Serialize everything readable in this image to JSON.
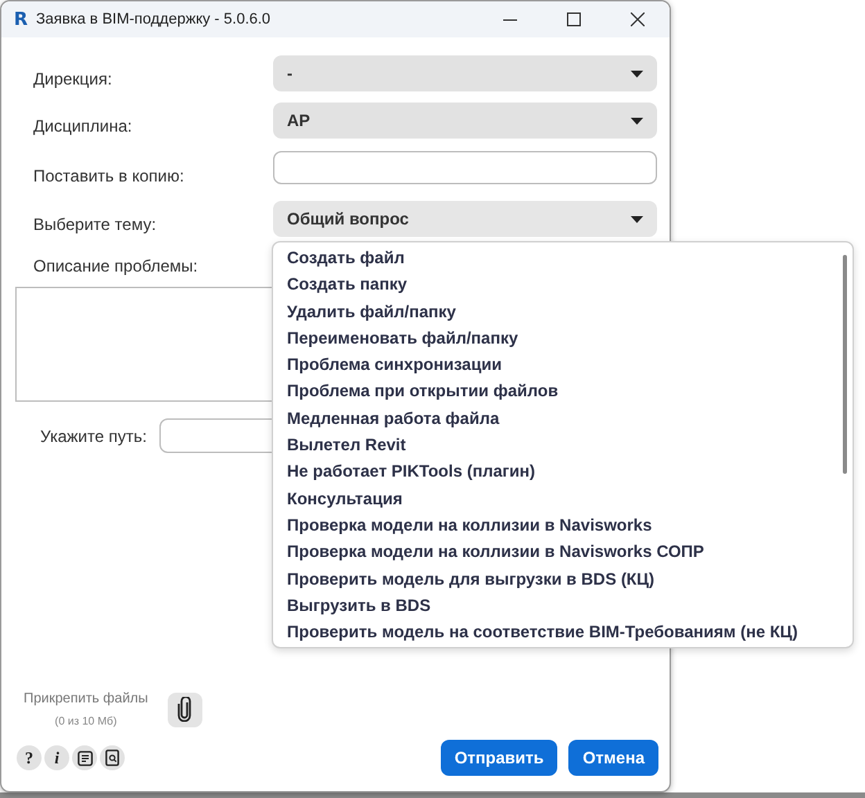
{
  "window": {
    "app_letter": "R",
    "title": "Заявка в BIM-поддержку - 5.0.6.0"
  },
  "fields": [
    {
      "kind": "combo",
      "label": "Дирекция:",
      "value": "-"
    },
    {
      "kind": "combo",
      "label": "Дисциплина:",
      "value": "АР"
    },
    {
      "kind": "text",
      "label": "Поставить в копию:"
    },
    {
      "kind": "combo",
      "label": "Выберите тему:",
      "value": "Общий вопрос",
      "expanded": true,
      "options": [
        "Создать файл",
        "Создать папку",
        "Удалить файл/папку",
        "Переименовать файл/папку",
        "Проблема синхронизации",
        "Проблема при открытии файлов",
        "Медленная работа файла",
        "Вылетел Revit",
        "Не работает PIKTools (плагин)",
        "Консультация",
        "Проверка модели на коллизии в Navisworks",
        "Проверка модели на коллизии в Navisworks СОПР",
        "Проверить модель для выгрузки в BDS (КЦ)",
        "Выгрузить в BDS",
        "Проверить модель на соответствие BIM-Требованиям (не КЦ)"
      ]
    }
  ],
  "description": {
    "label": "Описание проблемы:"
  },
  "path": {
    "label": "Укажите путь:"
  },
  "attach": {
    "label": "Прикрепить файлы",
    "size": "(0 из 10 Мб)"
  },
  "tools": [
    {
      "kind": "text",
      "label": "?"
    },
    {
      "kind": "text",
      "label": "i"
    },
    {
      "kind": "notes"
    },
    {
      "kind": "search-doc"
    }
  ],
  "buttons": [
    {
      "label": "Отправить"
    },
    {
      "label": "Отмена"
    }
  ]
}
